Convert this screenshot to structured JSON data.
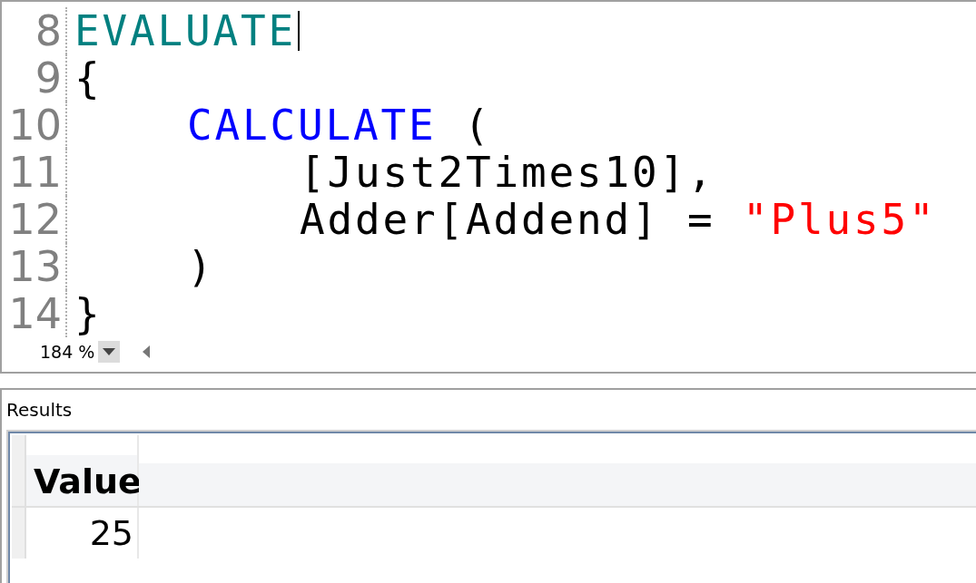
{
  "editor": {
    "lines": [
      {
        "number": "8",
        "tokens": [
          {
            "kind": "keyword",
            "text": "EVALUATE"
          }
        ]
      },
      {
        "number": "9",
        "tokens": [
          {
            "kind": "plain",
            "text": "{"
          }
        ],
        "children": [
          {
            "number": "10",
            "tokens": [
              {
                "kind": "function",
                "text": "CALCULATE"
              },
              {
                "kind": "plain",
                "text": " ("
              }
            ],
            "children": [
              {
                "number": "11",
                "tokens": [
                  {
                    "kind": "plain",
                    "text": "[Just2Times10],"
                  }
                ]
              },
              {
                "number": "12",
                "tokens": [
                  {
                    "kind": "plain",
                    "text": "Adder[Addend] = "
                  },
                  {
                    "kind": "string",
                    "text": "\"Plus5\""
                  }
                ]
              }
            ]
          },
          {
            "number": "13",
            "tokens": [
              {
                "kind": "plain",
                "text": ")"
              }
            ]
          }
        ]
      },
      {
        "number": "14",
        "tokens": [
          {
            "kind": "plain",
            "text": "}"
          }
        ]
      }
    ],
    "zoom": "184 %"
  },
  "results": {
    "title": "Results",
    "columns": [
      "Value"
    ],
    "rows": [
      [
        "25"
      ]
    ]
  }
}
